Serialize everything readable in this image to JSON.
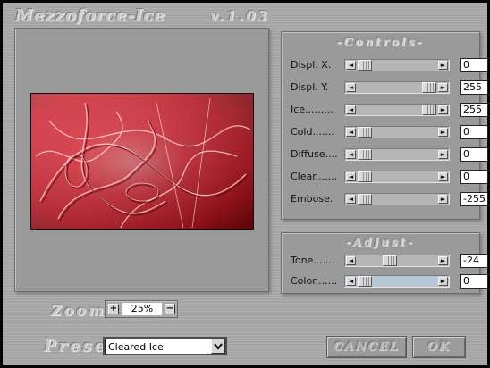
{
  "window": {
    "title": "Mezzoforce-Ice",
    "version": "v.1.03"
  },
  "controls": {
    "title": "-Controls-",
    "rows": [
      {
        "label": "Displ. X.",
        "value": "0",
        "position": 0.0
      },
      {
        "label": "Displ. Y.",
        "value": "255",
        "position": 1.0
      },
      {
        "label": "Ice.........",
        "value": "255",
        "position": 1.0
      },
      {
        "label": "Cold.......",
        "value": "0",
        "position": 0.0
      },
      {
        "label": "Diffuse....",
        "value": "0",
        "position": 0.0
      },
      {
        "label": "Clear.......",
        "value": "0",
        "position": 0.0
      },
      {
        "label": "Embose.",
        "value": "-255",
        "position": 0.0
      }
    ]
  },
  "adjust": {
    "title": "-Adjust-",
    "rows": [
      {
        "label": "Tone.......",
        "value": "-24",
        "position": 0.45
      },
      {
        "label": "Color.......",
        "value": "0",
        "position": 0.0
      }
    ]
  },
  "zoom": {
    "label": "Zoom",
    "value": "25%",
    "in_symbol": "+",
    "out_symbol": "−"
  },
  "preset": {
    "label": "Preset",
    "selected": "Cleared Ice",
    "dropdown_icon": "chevron-down-icon"
  },
  "buttons": {
    "cancel": "CANCEL",
    "ok": "OK"
  },
  "colors": {
    "panel_bg": "#999a99",
    "frame_bg": "#a9aaa9",
    "preview_red": "#d41424"
  }
}
